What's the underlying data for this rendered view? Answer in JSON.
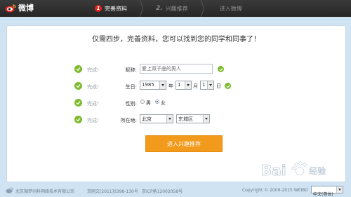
{
  "header": {
    "logo_text": "微博",
    "steps": [
      {
        "num": "1",
        "label": "完善资料",
        "active": true
      },
      {
        "num": "2.",
        "label": "兴趣推荐",
        "active": false
      },
      {
        "num": "",
        "label": "进入微博",
        "active": false
      }
    ]
  },
  "main": {
    "title": "仅需四步，完善资料，您可以找到您的同学和同事了！",
    "done_text": "完成!",
    "nickname": {
      "label": "昵称:",
      "value": "爱上双子座的男人"
    },
    "birthday": {
      "label": "生日:",
      "year": "1985",
      "year_unit": "年",
      "month": "1",
      "month_unit": "月",
      "day": "1",
      "day_unit": "日"
    },
    "gender": {
      "label": "性别:",
      "options": [
        "男",
        "女"
      ],
      "selected": "女"
    },
    "location": {
      "label": "所在地:",
      "province": "北京",
      "district": "东城区"
    },
    "submit_label": "进入兴趣推荐"
  },
  "footer": {
    "company": "北京微梦创科网络技术有限公司",
    "license1": "京网文[2011]0398-130号",
    "license2": "京ICP备12002058号",
    "copyright": "Copyright © 2009-2015 WEIBO",
    "language": "中文(简体)"
  },
  "watermark": {
    "brand": "Bai",
    "sub": "经验"
  },
  "colors": {
    "accent_orange": "#f29a1c",
    "check_green": "#7dbb2d",
    "step_red": "#e2231a",
    "header_bg": "#2e2e2e"
  }
}
